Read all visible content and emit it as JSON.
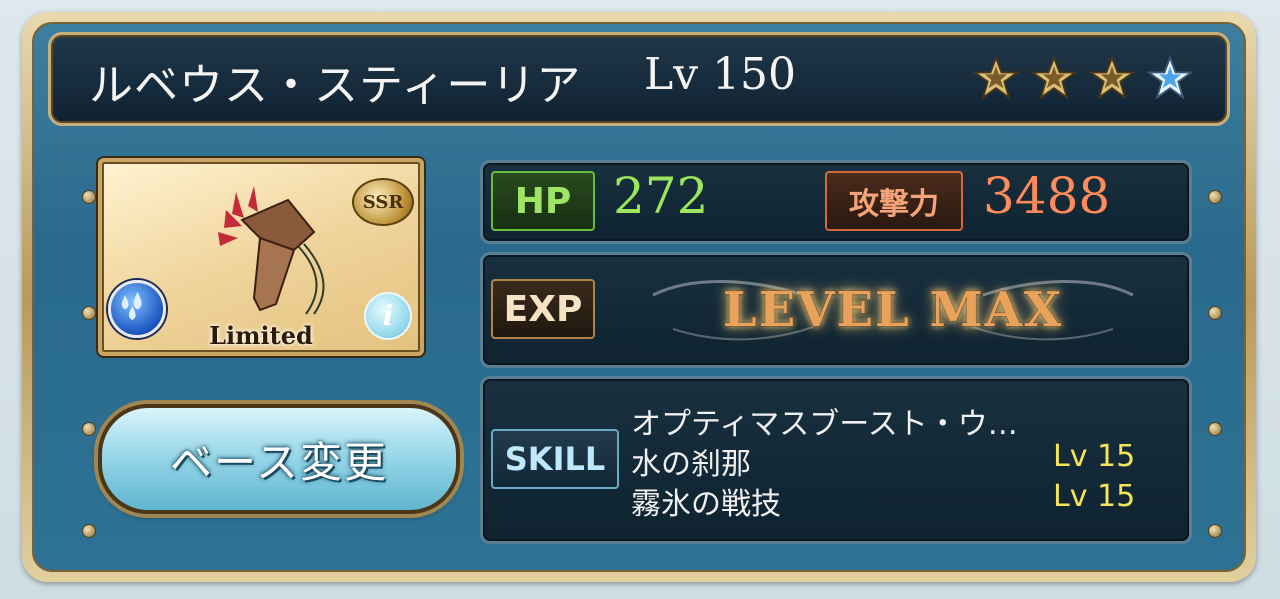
{
  "title": {
    "name": "ルベウス・スティーリア",
    "level": "Lv 150",
    "stars": 4
  },
  "portrait": {
    "rarity": "SSR",
    "caption": "Limited",
    "info": "i",
    "element_icon": "water-icon"
  },
  "buttons": {
    "base_change": "ベース変更"
  },
  "stats": {
    "hp_label": "HP",
    "hp_value": "272",
    "atk_label": "攻撃力",
    "atk_value": "3488"
  },
  "exp": {
    "label": "EXP",
    "status": "LEVEL MAX"
  },
  "skills": {
    "label": "SKILL",
    "items": [
      {
        "name": "オプティマスブースト・ウ…",
        "level": ""
      },
      {
        "name": "水の刹那",
        "level": "Lv 15"
      },
      {
        "name": "霧氷の戦技",
        "level": "Lv 15"
      }
    ]
  },
  "colors": {
    "hp": "#9be65a",
    "atk": "#ff8a5a",
    "skill_level": "#f5e35a",
    "frame_gold": "#c9b07a",
    "panel_blue": "#2a6a8c"
  }
}
